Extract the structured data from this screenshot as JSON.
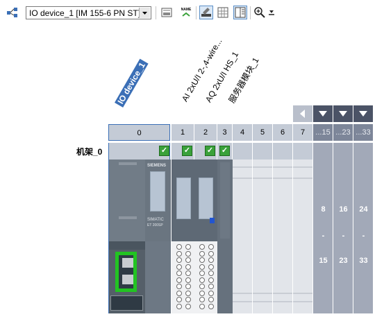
{
  "toolbar": {
    "device_select": "IO device_1 [IM 155-6 PN ST]",
    "name_button_label": "NAME",
    "icons": [
      "network-view-icon",
      "device-overview-icon",
      "show-module-names-icon",
      "draw-icon",
      "table-view-icon",
      "properties-view-icon",
      "zoom-in-icon",
      "download-icon"
    ]
  },
  "labels": {
    "device": "IO device_1",
    "module1": "AI 2xU/I 2-,4-wire...",
    "module2": "AQ 2xU/I HS_1",
    "module3": "服务器模块_1"
  },
  "rack": {
    "name": "机架_0",
    "slots": [
      "0",
      "1",
      "2",
      "3",
      "4",
      "5",
      "6",
      "7"
    ],
    "group_headers": [
      "...15",
      "...23",
      "...33"
    ],
    "group_ranges": [
      {
        "start": "8",
        "dash": "-",
        "end": "15"
      },
      {
        "start": "16",
        "dash": "-",
        "end": "23"
      },
      {
        "start": "24",
        "dash": "-",
        "end": "33"
      }
    ]
  },
  "module_text": {
    "brand": "SIEMENS",
    "model": "SIMATIC",
    "series": "ET 200SP"
  },
  "colors": {
    "selection": "#3b6fb6",
    "check": "#3aa13a",
    "port_highlight": "#22c322",
    "header": "#c4cbd6",
    "dark_column": "#a2a9b8"
  }
}
